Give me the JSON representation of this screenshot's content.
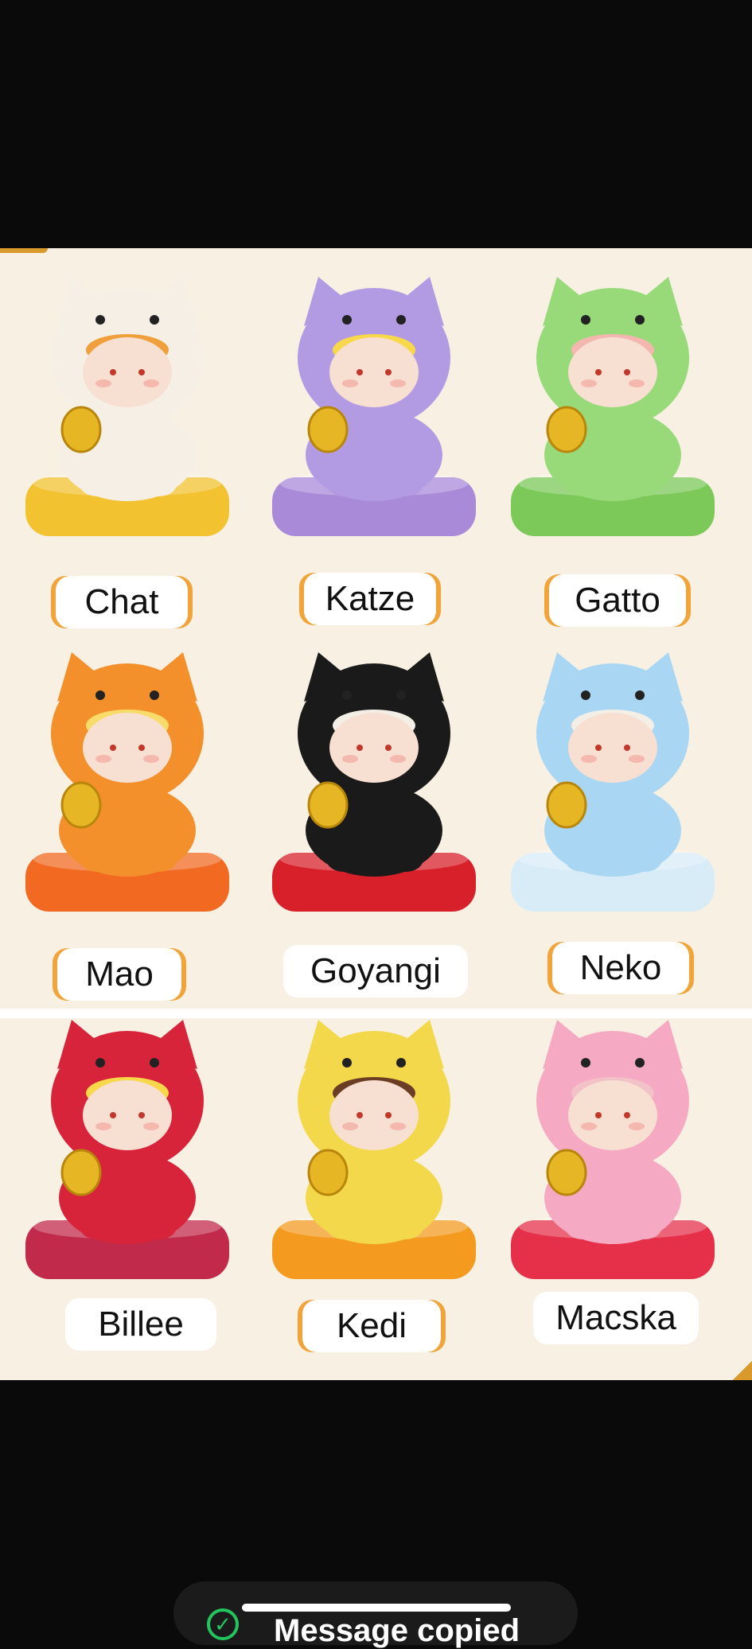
{
  "product_image": {
    "figures": [
      {
        "name": "Chat",
        "body_color": "#f6efe6",
        "accent_color": "#f0a03a",
        "cushion_color": "#f2c230"
      },
      {
        "name": "Katze",
        "body_color": "#b39be3",
        "accent_color": "#f7d84a",
        "cushion_color": "#a88ad8"
      },
      {
        "name": "Gatto",
        "body_color": "#98d97a",
        "accent_color": "#f3b7b0",
        "cushion_color": "#7cc95a"
      },
      {
        "name": "Mao",
        "body_color": "#f3902c",
        "accent_color": "#f7dc6a",
        "cushion_color": "#f26a22"
      },
      {
        "name": "Goyangi",
        "body_color": "#1a1a1a",
        "accent_color": "#f3efe6",
        "cushion_color": "#d8202a"
      },
      {
        "name": "Neko",
        "body_color": "#a9d6f2",
        "accent_color": "#f3efe6",
        "cushion_color": "#d8ecf7"
      },
      {
        "name": "Billee",
        "body_color": "#d8243a",
        "accent_color": "#f7d84a",
        "cushion_color": "#c12a4a"
      },
      {
        "name": "Kedi",
        "body_color": "#f2d84a",
        "accent_color": "#6b3d24",
        "cushion_color": "#f39a1f"
      },
      {
        "name": "Macska",
        "body_color": "#f6a9c2",
        "accent_color": "#f3c2c8",
        "cushion_color": "#e6304a"
      }
    ]
  },
  "toast": {
    "icon": "check-circle-icon",
    "message": "Message copied"
  },
  "colors": {
    "background": "#0a0a0a",
    "photo_background": "#f8f1e3",
    "label_accent": "#f0a43a",
    "success": "#22c55e"
  }
}
